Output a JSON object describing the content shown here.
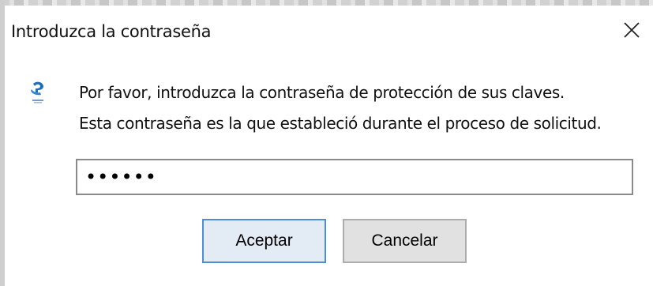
{
  "dialog": {
    "title": "Introduzca la contraseña",
    "message_line1": "Por favor, introduzca la contraseña de protección de sus claves.",
    "message_line2": "Esta contraseña es la que estableció durante el proceso de solicitud.",
    "password_value": "••••••",
    "ok_label": "Aceptar",
    "cancel_label": "Cancelar",
    "icons": {
      "close": "close-icon",
      "app": "key-icon"
    },
    "colors": {
      "ok_border": "#4a8fd8",
      "icon_blue": "#1f6fb8"
    }
  }
}
